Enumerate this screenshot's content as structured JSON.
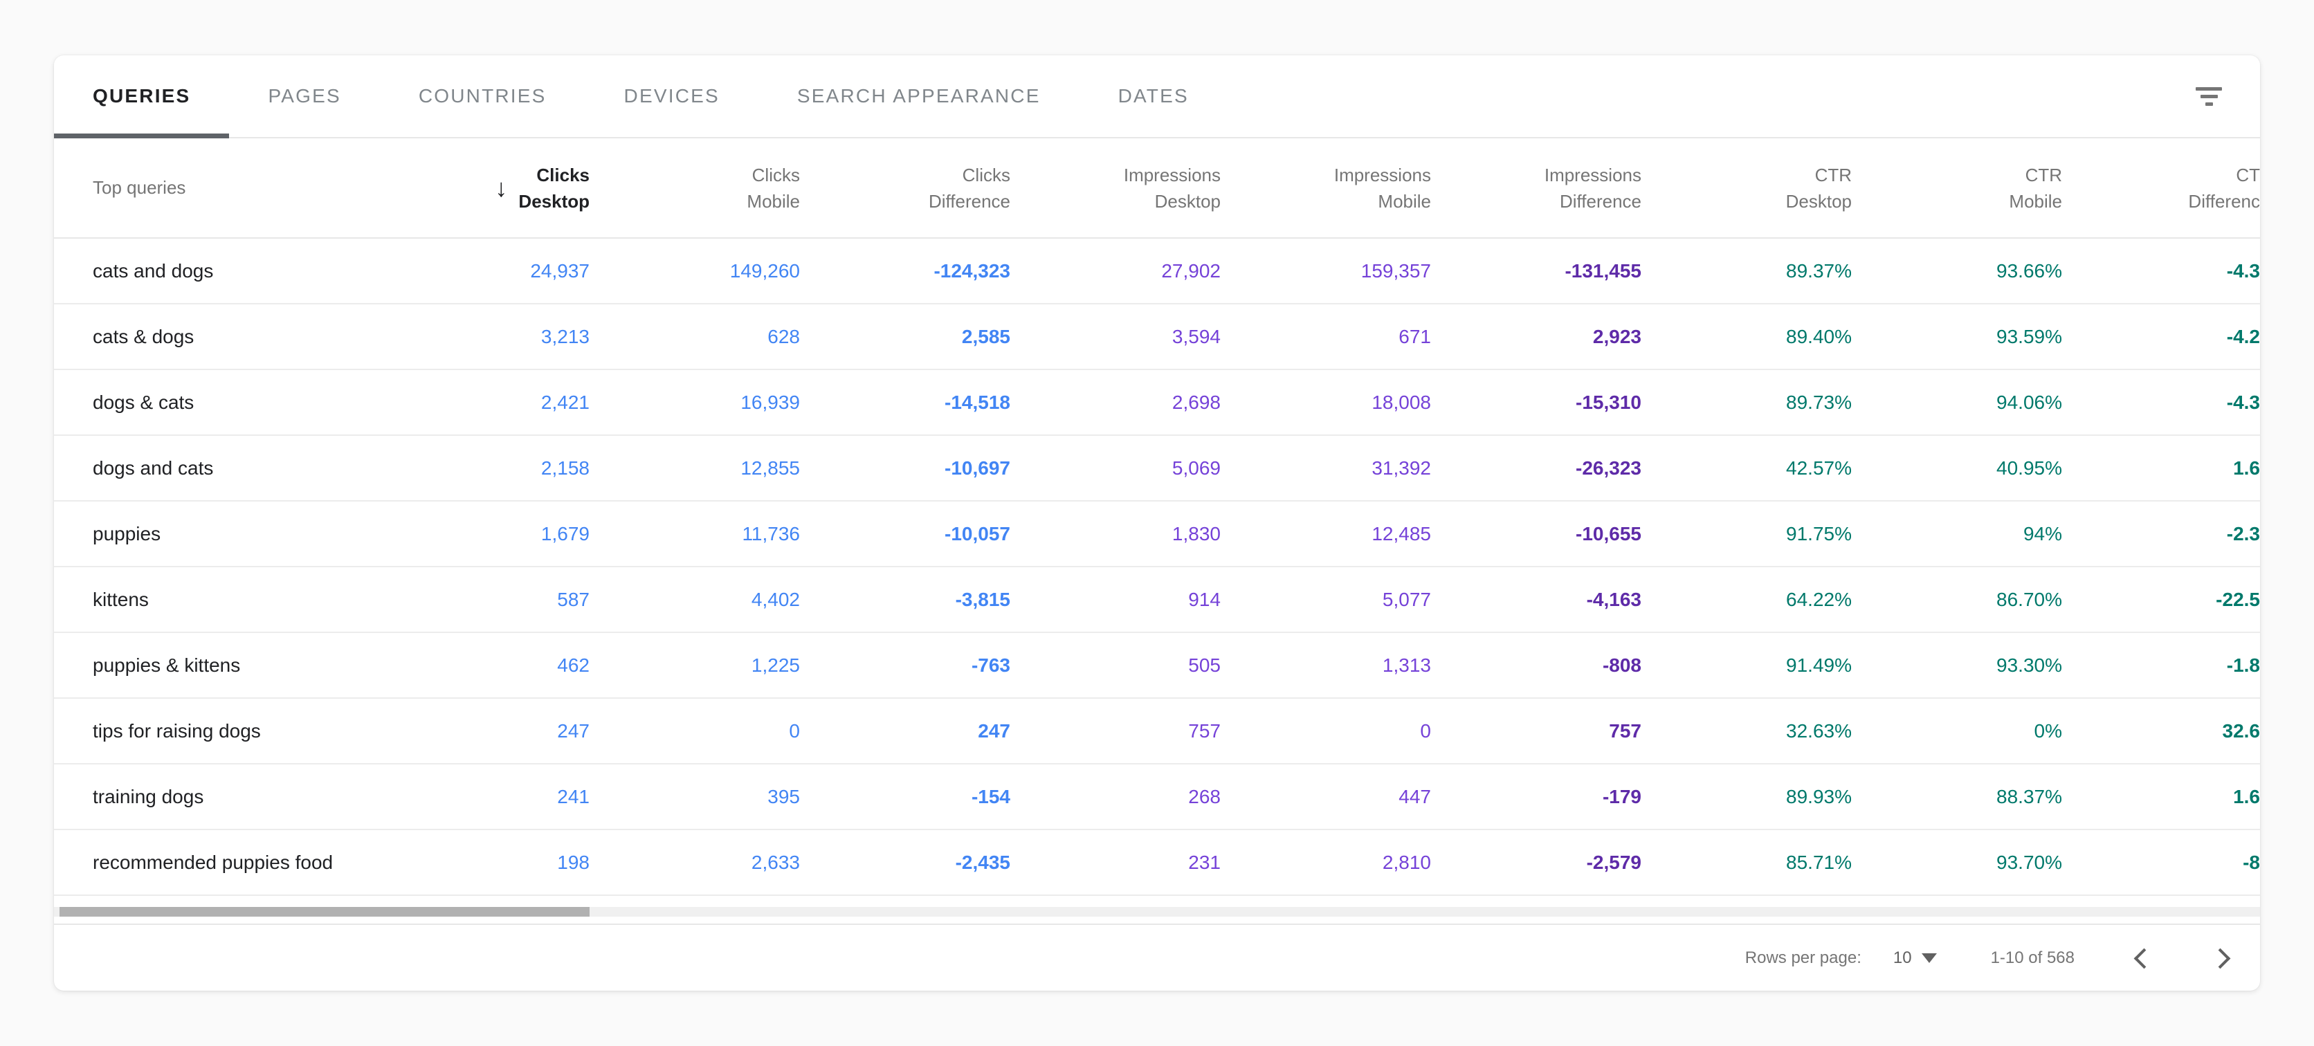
{
  "tabs": [
    {
      "label": "QUERIES",
      "active": true
    },
    {
      "label": "PAGES",
      "active": false
    },
    {
      "label": "COUNTRIES",
      "active": false
    },
    {
      "label": "DEVICES",
      "active": false
    },
    {
      "label": "SEARCH APPEARANCE",
      "active": false
    },
    {
      "label": "DATES",
      "active": false
    }
  ],
  "toolbar": {
    "filter_icon": "filter-list-icon"
  },
  "table": {
    "row_header": "Top queries",
    "sort_arrow": "↓",
    "fields": [
      "clicks_desktop",
      "clicks_mobile",
      "clicks_diff",
      "impr_desktop",
      "impr_mobile",
      "impr_diff",
      "ctr_desktop",
      "ctr_mobile",
      "ctr_diff"
    ],
    "columns": [
      {
        "line1": "Clicks",
        "line2": "Desktop",
        "sorted": true
      },
      {
        "line1": "Clicks",
        "line2": "Mobile",
        "sorted": false
      },
      {
        "line1": "Clicks",
        "line2": "Difference",
        "sorted": false
      },
      {
        "line1": "Impressions",
        "line2": "Desktop",
        "sorted": false
      },
      {
        "line1": "Impressions",
        "line2": "Mobile",
        "sorted": false
      },
      {
        "line1": "Impressions",
        "line2": "Difference",
        "sorted": false
      },
      {
        "line1": "CTR",
        "line2": "Desktop",
        "sorted": false
      },
      {
        "line1": "CTR",
        "line2": "Mobile",
        "sorted": false
      },
      {
        "line1": "CT",
        "line2": "Differenc",
        "sorted": false,
        "clipped": true
      }
    ],
    "rows": [
      {
        "query": "cats and dogs",
        "clicks_desktop": "24,937",
        "clicks_mobile": "149,260",
        "clicks_diff": "-124,323",
        "impr_desktop": "27,902",
        "impr_mobile": "159,357",
        "impr_diff": "-131,455",
        "ctr_desktop": "89.37%",
        "ctr_mobile": "93.66%",
        "ctr_diff": "-4.3"
      },
      {
        "query": "cats & dogs",
        "clicks_desktop": "3,213",
        "clicks_mobile": "628",
        "clicks_diff": "2,585",
        "impr_desktop": "3,594",
        "impr_mobile": "671",
        "impr_diff": "2,923",
        "ctr_desktop": "89.40%",
        "ctr_mobile": "93.59%",
        "ctr_diff": "-4.2"
      },
      {
        "query": "dogs & cats",
        "clicks_desktop": "2,421",
        "clicks_mobile": "16,939",
        "clicks_diff": "-14,518",
        "impr_desktop": "2,698",
        "impr_mobile": "18,008",
        "impr_diff": "-15,310",
        "ctr_desktop": "89.73%",
        "ctr_mobile": "94.06%",
        "ctr_diff": "-4.3"
      },
      {
        "query": "dogs and cats",
        "clicks_desktop": "2,158",
        "clicks_mobile": "12,855",
        "clicks_diff": "-10,697",
        "impr_desktop": "5,069",
        "impr_mobile": "31,392",
        "impr_diff": "-26,323",
        "ctr_desktop": "42.57%",
        "ctr_mobile": "40.95%",
        "ctr_diff": "1.6"
      },
      {
        "query": "puppies",
        "clicks_desktop": "1,679",
        "clicks_mobile": "11,736",
        "clicks_diff": "-10,057",
        "impr_desktop": "1,830",
        "impr_mobile": "12,485",
        "impr_diff": "-10,655",
        "ctr_desktop": "91.75%",
        "ctr_mobile": "94%",
        "ctr_diff": "-2.3"
      },
      {
        "query": "kittens",
        "clicks_desktop": "587",
        "clicks_mobile": "4,402",
        "clicks_diff": "-3,815",
        "impr_desktop": "914",
        "impr_mobile": "5,077",
        "impr_diff": "-4,163",
        "ctr_desktop": "64.22%",
        "ctr_mobile": "86.70%",
        "ctr_diff": "-22.5"
      },
      {
        "query": "puppies & kittens",
        "clicks_desktop": "462",
        "clicks_mobile": "1,225",
        "clicks_diff": "-763",
        "impr_desktop": "505",
        "impr_mobile": "1,313",
        "impr_diff": "-808",
        "ctr_desktop": "91.49%",
        "ctr_mobile": "93.30%",
        "ctr_diff": "-1.8"
      },
      {
        "query": "tips for raising dogs",
        "clicks_desktop": "247",
        "clicks_mobile": "0",
        "clicks_diff": "247",
        "impr_desktop": "757",
        "impr_mobile": "0",
        "impr_diff": "757",
        "ctr_desktop": "32.63%",
        "ctr_mobile": "0%",
        "ctr_diff": "32.6"
      },
      {
        "query": "training dogs",
        "clicks_desktop": "241",
        "clicks_mobile": "395",
        "clicks_diff": "-154",
        "impr_desktop": "268",
        "impr_mobile": "447",
        "impr_diff": "-179",
        "ctr_desktop": "89.93%",
        "ctr_mobile": "88.37%",
        "ctr_diff": "1.6"
      },
      {
        "query": "recommended puppies food",
        "clicks_desktop": "198",
        "clicks_mobile": "2,633",
        "clicks_diff": "-2,435",
        "impr_desktop": "231",
        "impr_mobile": "2,810",
        "impr_diff": "-2,579",
        "ctr_desktop": "85.71%",
        "ctr_mobile": "93.70%",
        "ctr_diff": "-8"
      }
    ]
  },
  "pagination": {
    "rows_per_page_label": "Rows per page:",
    "rows_per_page_value": "10",
    "range_label": "1-10 of 568"
  },
  "colors": {
    "accent": "#5f6368",
    "clicks": "#4285f4",
    "impressions": "#7542d8",
    "impressions_diff": "#5e2ba8",
    "ctr": "#00796b"
  }
}
